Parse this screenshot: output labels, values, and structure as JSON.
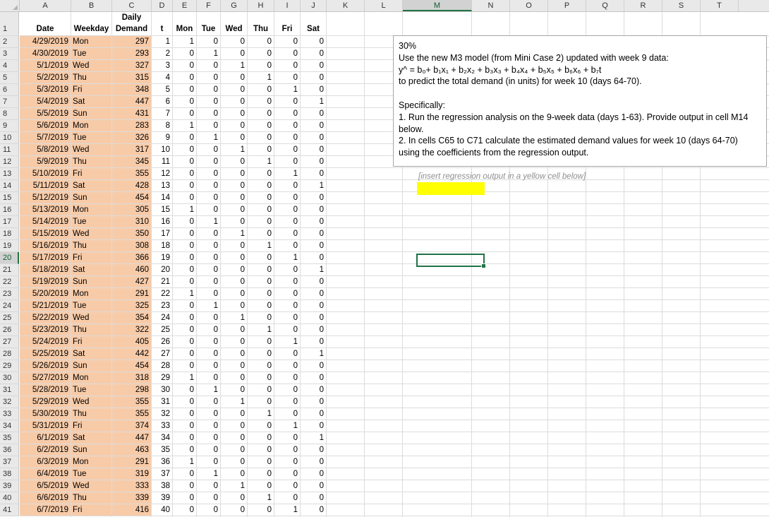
{
  "columns": [
    "A",
    "B",
    "C",
    "D",
    "E",
    "F",
    "G",
    "H",
    "I",
    "J",
    "K",
    "L",
    "M",
    "N",
    "O",
    "P",
    "Q",
    "R",
    "S",
    "T"
  ],
  "selected_column": "M",
  "selected_row": 20,
  "header_row1": {
    "C": "Daily"
  },
  "header_row2": [
    "Date",
    "Weekday",
    "Demand",
    "t",
    "Mon",
    "Tue",
    "Wed",
    "Thu",
    "Fri",
    "Sat"
  ],
  "rows": [
    [
      "4/29/2019",
      "Mon",
      "297",
      "1",
      "1",
      "0",
      "0",
      "0",
      "0",
      "0"
    ],
    [
      "4/30/2019",
      "Tue",
      "293",
      "2",
      "0",
      "1",
      "0",
      "0",
      "0",
      "0"
    ],
    [
      "5/1/2019",
      "Wed",
      "327",
      "3",
      "0",
      "0",
      "1",
      "0",
      "0",
      "0"
    ],
    [
      "5/2/2019",
      "Thu",
      "315",
      "4",
      "0",
      "0",
      "0",
      "1",
      "0",
      "0"
    ],
    [
      "5/3/2019",
      "Fri",
      "348",
      "5",
      "0",
      "0",
      "0",
      "0",
      "1",
      "0"
    ],
    [
      "5/4/2019",
      "Sat",
      "447",
      "6",
      "0",
      "0",
      "0",
      "0",
      "0",
      "1"
    ],
    [
      "5/5/2019",
      "Sun",
      "431",
      "7",
      "0",
      "0",
      "0",
      "0",
      "0",
      "0"
    ],
    [
      "5/6/2019",
      "Mon",
      "283",
      "8",
      "1",
      "0",
      "0",
      "0",
      "0",
      "0"
    ],
    [
      "5/7/2019",
      "Tue",
      "326",
      "9",
      "0",
      "1",
      "0",
      "0",
      "0",
      "0"
    ],
    [
      "5/8/2019",
      "Wed",
      "317",
      "10",
      "0",
      "0",
      "1",
      "0",
      "0",
      "0"
    ],
    [
      "5/9/2019",
      "Thu",
      "345",
      "11",
      "0",
      "0",
      "0",
      "1",
      "0",
      "0"
    ],
    [
      "5/10/2019",
      "Fri",
      "355",
      "12",
      "0",
      "0",
      "0",
      "0",
      "1",
      "0"
    ],
    [
      "5/11/2019",
      "Sat",
      "428",
      "13",
      "0",
      "0",
      "0",
      "0",
      "0",
      "1"
    ],
    [
      "5/12/2019",
      "Sun",
      "454",
      "14",
      "0",
      "0",
      "0",
      "0",
      "0",
      "0"
    ],
    [
      "5/13/2019",
      "Mon",
      "305",
      "15",
      "1",
      "0",
      "0",
      "0",
      "0",
      "0"
    ],
    [
      "5/14/2019",
      "Tue",
      "310",
      "16",
      "0",
      "1",
      "0",
      "0",
      "0",
      "0"
    ],
    [
      "5/15/2019",
      "Wed",
      "350",
      "17",
      "0",
      "0",
      "1",
      "0",
      "0",
      "0"
    ],
    [
      "5/16/2019",
      "Thu",
      "308",
      "18",
      "0",
      "0",
      "0",
      "1",
      "0",
      "0"
    ],
    [
      "5/17/2019",
      "Fri",
      "366",
      "19",
      "0",
      "0",
      "0",
      "0",
      "1",
      "0"
    ],
    [
      "5/18/2019",
      "Sat",
      "460",
      "20",
      "0",
      "0",
      "0",
      "0",
      "0",
      "1"
    ],
    [
      "5/19/2019",
      "Sun",
      "427",
      "21",
      "0",
      "0",
      "0",
      "0",
      "0",
      "0"
    ],
    [
      "5/20/2019",
      "Mon",
      "291",
      "22",
      "1",
      "0",
      "0",
      "0",
      "0",
      "0"
    ],
    [
      "5/21/2019",
      "Tue",
      "325",
      "23",
      "0",
      "1",
      "0",
      "0",
      "0",
      "0"
    ],
    [
      "5/22/2019",
      "Wed",
      "354",
      "24",
      "0",
      "0",
      "1",
      "0",
      "0",
      "0"
    ],
    [
      "5/23/2019",
      "Thu",
      "322",
      "25",
      "0",
      "0",
      "0",
      "1",
      "0",
      "0"
    ],
    [
      "5/24/2019",
      "Fri",
      "405",
      "26",
      "0",
      "0",
      "0",
      "0",
      "1",
      "0"
    ],
    [
      "5/25/2019",
      "Sat",
      "442",
      "27",
      "0",
      "0",
      "0",
      "0",
      "0",
      "1"
    ],
    [
      "5/26/2019",
      "Sun",
      "454",
      "28",
      "0",
      "0",
      "0",
      "0",
      "0",
      "0"
    ],
    [
      "5/27/2019",
      "Mon",
      "318",
      "29",
      "1",
      "0",
      "0",
      "0",
      "0",
      "0"
    ],
    [
      "5/28/2019",
      "Tue",
      "298",
      "30",
      "0",
      "1",
      "0",
      "0",
      "0",
      "0"
    ],
    [
      "5/29/2019",
      "Wed",
      "355",
      "31",
      "0",
      "0",
      "1",
      "0",
      "0",
      "0"
    ],
    [
      "5/30/2019",
      "Thu",
      "355",
      "32",
      "0",
      "0",
      "0",
      "1",
      "0",
      "0"
    ],
    [
      "5/31/2019",
      "Fri",
      "374",
      "33",
      "0",
      "0",
      "0",
      "0",
      "1",
      "0"
    ],
    [
      "6/1/2019",
      "Sat",
      "447",
      "34",
      "0",
      "0",
      "0",
      "0",
      "0",
      "1"
    ],
    [
      "6/2/2019",
      "Sun",
      "463",
      "35",
      "0",
      "0",
      "0",
      "0",
      "0",
      "0"
    ],
    [
      "6/3/2019",
      "Mon",
      "291",
      "36",
      "1",
      "0",
      "0",
      "0",
      "0",
      "0"
    ],
    [
      "6/4/2019",
      "Tue",
      "319",
      "37",
      "0",
      "1",
      "0",
      "0",
      "0",
      "0"
    ],
    [
      "6/5/2019",
      "Wed",
      "333",
      "38",
      "0",
      "0",
      "1",
      "0",
      "0",
      "0"
    ],
    [
      "6/6/2019",
      "Thu",
      "339",
      "39",
      "0",
      "0",
      "0",
      "1",
      "0",
      "0"
    ],
    [
      "6/7/2019",
      "Fri",
      "416",
      "40",
      "0",
      "0",
      "0",
      "0",
      "1",
      "0"
    ]
  ],
  "note": {
    "line1": "30%",
    "line2": "Use the new M3 model (from Mini Case 2) updated with week 9 data:",
    "line3": "y^ = b₀+ b₁x₁ + b₂x₂ + b₃x₃ + b₄x₄ + b₅x₅ + b₆x₆ + b₇t",
    "line4": "to predict the total demand (in units) for week 10 (days 64-70).",
    "line5": "Specifically:",
    "line6": "1. Run the regression analysis on the 9-week data (days 1-63). Provide output in cell M14",
    "line7": "below.",
    "line8": "2. In cells C65 to C71 calculate the estimated demand values for week 10 (days 64-70)",
    "line9": "using the coefficients from the regression output."
  },
  "hint": "[insert regression output  in a yellow cell below]",
  "colors": {
    "orange": "#f8cba8",
    "yellow": "#ffff00",
    "select": "#217346"
  }
}
